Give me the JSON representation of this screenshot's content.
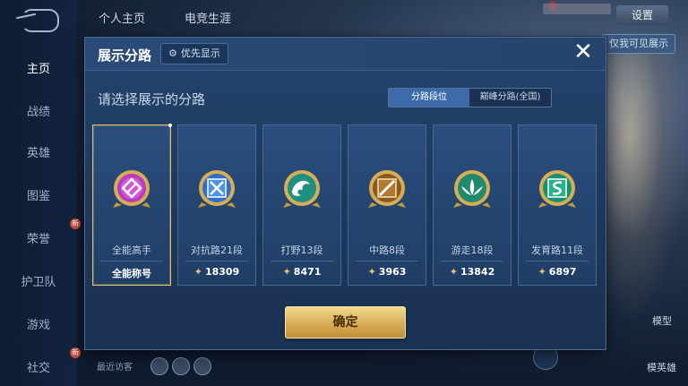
{
  "background": {
    "sidebar": [
      {
        "label": "主页",
        "active": true
      },
      {
        "label": "战绩",
        "active": false
      },
      {
        "label": "英雄",
        "active": false
      },
      {
        "label": "图鉴",
        "active": false
      },
      {
        "label": "荣誉",
        "active": false
      },
      {
        "label": "护卫队",
        "active": false
      },
      {
        "label": "游戏",
        "active": false
      },
      {
        "label": "社交",
        "active": false
      }
    ],
    "top_tabs": [
      "个人主页",
      "电竞生涯"
    ],
    "top_right_button": "设置",
    "show_button": "仅我可见展示",
    "right_labels": [
      "模型",
      "模英雄"
    ],
    "recent_label": "最近访客"
  },
  "modal": {
    "title": "展示分路",
    "priority_button": "优先显示",
    "close_symbol": "✕",
    "subtitle": "请选择展示的分路",
    "segments": {
      "active": "分路段位",
      "inactive": "巅峰分路(全国)"
    },
    "cards": [
      {
        "name": "全能高手",
        "score": "全能称号",
        "score_icon": false,
        "icon": "all-round-emblem",
        "color": "#b83cbf",
        "selected": true
      },
      {
        "name": "对抗路21段",
        "score": "18309",
        "score_icon": true,
        "icon": "clash-lane-emblem",
        "color": "#2f6fc9",
        "selected": false
      },
      {
        "name": "打野13段",
        "score": "8471",
        "score_icon": true,
        "icon": "jungle-emblem",
        "color": "#1f8f82",
        "selected": false
      },
      {
        "name": "中路8段",
        "score": "3963",
        "score_icon": true,
        "icon": "mid-lane-emblem",
        "color": "#b07a2e",
        "selected": false
      },
      {
        "name": "游走18段",
        "score": "13842",
        "score_icon": true,
        "icon": "roam-emblem",
        "color": "#1f8a6e",
        "selected": false
      },
      {
        "name": "发育路11段",
        "score": "6897",
        "score_icon": true,
        "icon": "farm-lane-emblem",
        "color": "#1a8f72",
        "selected": false
      }
    ],
    "confirm_button": "确定"
  }
}
